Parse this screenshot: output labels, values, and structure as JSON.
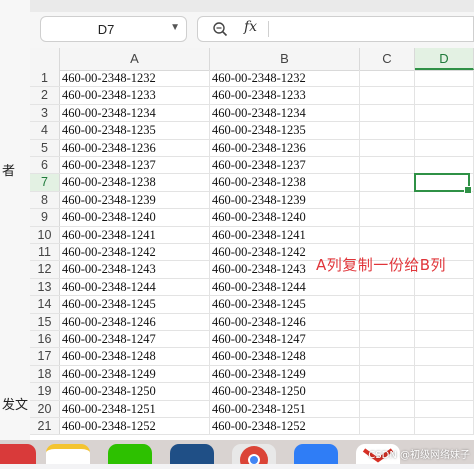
{
  "left_strip": {
    "frag1": "者",
    "frag2": "发文"
  },
  "formula_bar": {
    "cell_ref": "D7",
    "fx_label": "fx",
    "formula_value": ""
  },
  "columns": [
    "A",
    "B",
    "C",
    "D"
  ],
  "active_column": "D",
  "active_row": 7,
  "rows": [
    {
      "n": "1",
      "a": "460-00-2348-1232",
      "b": "460-00-2348-1232"
    },
    {
      "n": "2",
      "a": "460-00-2348-1233",
      "b": "460-00-2348-1233"
    },
    {
      "n": "3",
      "a": "460-00-2348-1234",
      "b": "460-00-2348-1234"
    },
    {
      "n": "4",
      "a": "460-00-2348-1235",
      "b": "460-00-2348-1235"
    },
    {
      "n": "5",
      "a": "460-00-2348-1236",
      "b": "460-00-2348-1236"
    },
    {
      "n": "6",
      "a": "460-00-2348-1237",
      "b": "460-00-2348-1237"
    },
    {
      "n": "7",
      "a": "460-00-2348-1238",
      "b": "460-00-2348-1238"
    },
    {
      "n": "8",
      "a": "460-00-2348-1239",
      "b": "460-00-2348-1239"
    },
    {
      "n": "9",
      "a": "460-00-2348-1240",
      "b": "460-00-2348-1240"
    },
    {
      "n": "10",
      "a": "460-00-2348-1241",
      "b": "460-00-2348-1241"
    },
    {
      "n": "11",
      "a": "460-00-2348-1242",
      "b": "460-00-2348-1242"
    },
    {
      "n": "12",
      "a": "460-00-2348-1243",
      "b": "460-00-2348-1243"
    },
    {
      "n": "13",
      "a": "460-00-2348-1244",
      "b": "460-00-2348-1244"
    },
    {
      "n": "14",
      "a": "460-00-2348-1245",
      "b": "460-00-2348-1245"
    },
    {
      "n": "15",
      "a": "460-00-2348-1246",
      "b": "460-00-2348-1246"
    },
    {
      "n": "16",
      "a": "460-00-2348-1247",
      "b": "460-00-2348-1247"
    },
    {
      "n": "17",
      "a": "460-00-2348-1248",
      "b": "460-00-2348-1248"
    },
    {
      "n": "18",
      "a": "460-00-2348-1249",
      "b": "460-00-2348-1249"
    },
    {
      "n": "19",
      "a": "460-00-2348-1250",
      "b": "460-00-2348-1250"
    },
    {
      "n": "20",
      "a": "460-00-2348-1251",
      "b": "460-00-2348-1251"
    },
    {
      "n": "21",
      "a": "460-00-2348-1252",
      "b": "460-00-2348-1252"
    }
  ],
  "annotation": "A列复制一份给B列",
  "dock": {
    "icons": [
      "app-red-icon",
      "notes-icon",
      "wechat-icon",
      "vscode-icon",
      "chrome-icon",
      "dingtalk-icon",
      "gmail-icon"
    ],
    "watermark": "CSDN @初级网络妹子"
  },
  "colors": {
    "accent": "#2f9146",
    "annotation": "#e0353a"
  }
}
